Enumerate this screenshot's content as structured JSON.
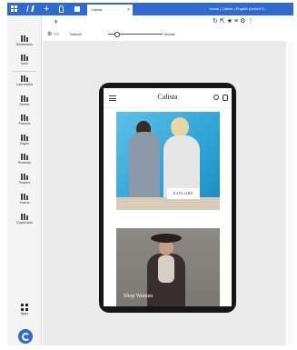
{
  "browser": {
    "tab": {
      "title": "Calista"
    },
    "window_title": "Yonas | Calista | English (United S..."
  },
  "sidebar": {
    "items": [
      {
        "label": "Bookmarks",
        "icon": "bookmarks-icon"
      },
      {
        "label": "Save",
        "icon": "save-icon"
      },
      {
        "label": "Last edited",
        "icon": "last-edited-icon"
      },
      {
        "label": "Stories",
        "icon": "stories-icon"
      },
      {
        "label": "Pictures",
        "icon": "pictures-icon"
      },
      {
        "label": "Pages",
        "icon": "pages-icon"
      },
      {
        "label": "Products",
        "icon": "products-icon"
      },
      {
        "label": "Teasers",
        "icon": "teasers-icon"
      },
      {
        "label": "Videos",
        "icon": "videos-icon"
      },
      {
        "label": "Downloads",
        "icon": "downloads-icon"
      }
    ],
    "apps_label": "Apps"
  },
  "toolbar": {
    "profile": "Default",
    "device": "Mobile"
  },
  "preview": {
    "brand": "Calista",
    "hero_cta": "EXPLORE",
    "second_card_label": "Shop Women"
  },
  "colors": {
    "accent": "#2f6ad0",
    "canvas": "#ebebeb",
    "device_frame": "#161616"
  }
}
